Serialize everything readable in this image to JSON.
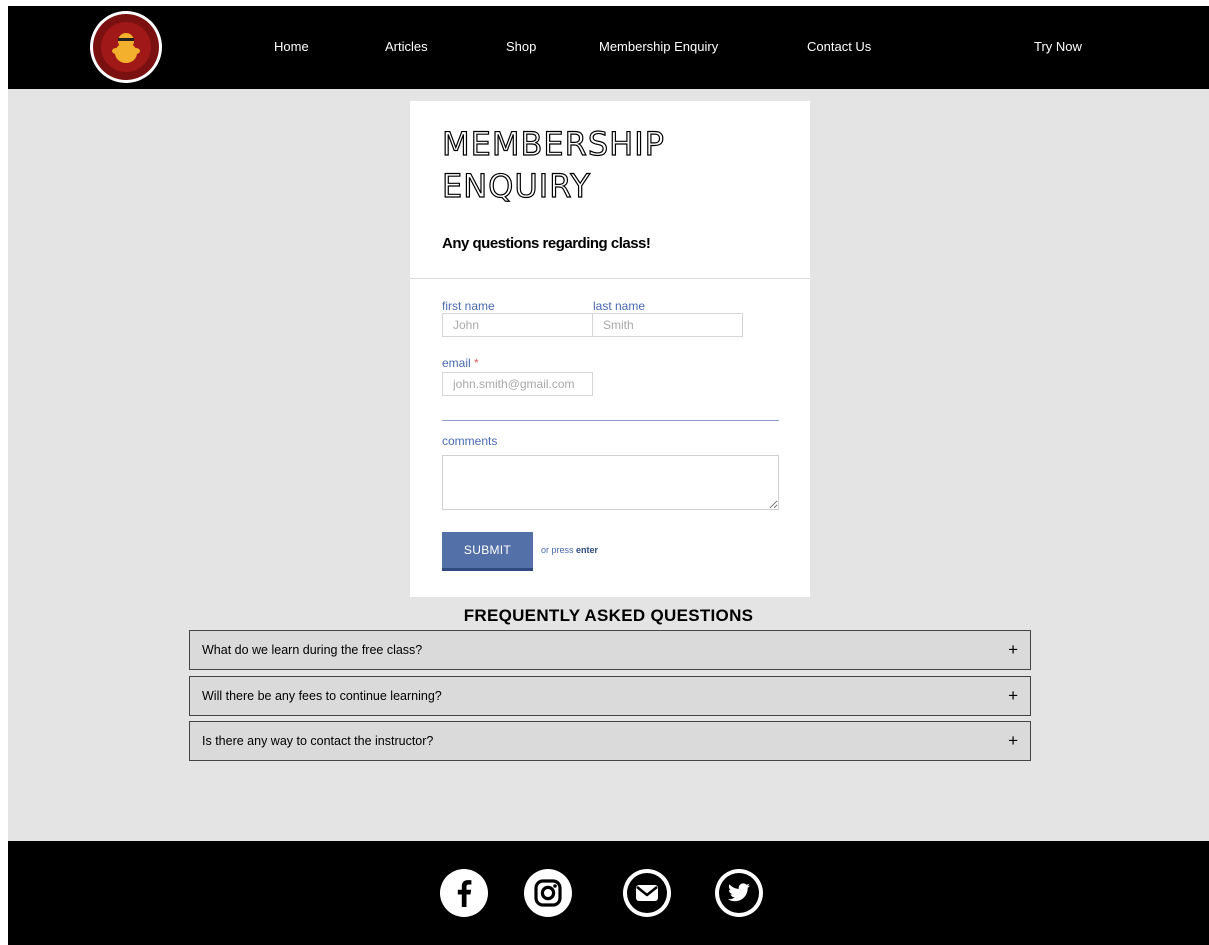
{
  "nav": {
    "items": [
      {
        "label": "Home"
      },
      {
        "label": "Articles"
      },
      {
        "label": "Shop"
      },
      {
        "label": "Membership Enquiry"
      },
      {
        "label": "Contact Us"
      },
      {
        "label": "Try Now"
      }
    ]
  },
  "form": {
    "title": "MEMBERSHIP ENQUIRY",
    "subtitle": "Any questions regarding class!",
    "first_name_label": "first name",
    "first_name_placeholder": "John",
    "last_name_label": "last name",
    "last_name_placeholder": "Smith",
    "email_label": "email",
    "email_required_mark": "*",
    "email_placeholder": "john.smith@gmail.com",
    "comments_label": "comments",
    "submit_label": "SUBMIT",
    "press_hint": "or press",
    "press_key": "enter"
  },
  "faq": {
    "title": "FREQUENTLY ASKED QUESTIONS",
    "items": [
      {
        "question": "What do we learn during the free class?",
        "toggle": "+"
      },
      {
        "question": "Will there be any fees to continue learning?",
        "toggle": "+"
      },
      {
        "question": "Is there any way to contact the instructor?",
        "toggle": "+"
      }
    ]
  },
  "footer": {
    "icons": [
      "facebook-icon",
      "instagram-icon",
      "mail-icon",
      "twitter-icon"
    ]
  },
  "colors": {
    "header_bg": "#000000",
    "page_bg": "#e4e4e4",
    "accent": "#5470a8",
    "label": "#4a6ab0",
    "required": "#e06060"
  }
}
